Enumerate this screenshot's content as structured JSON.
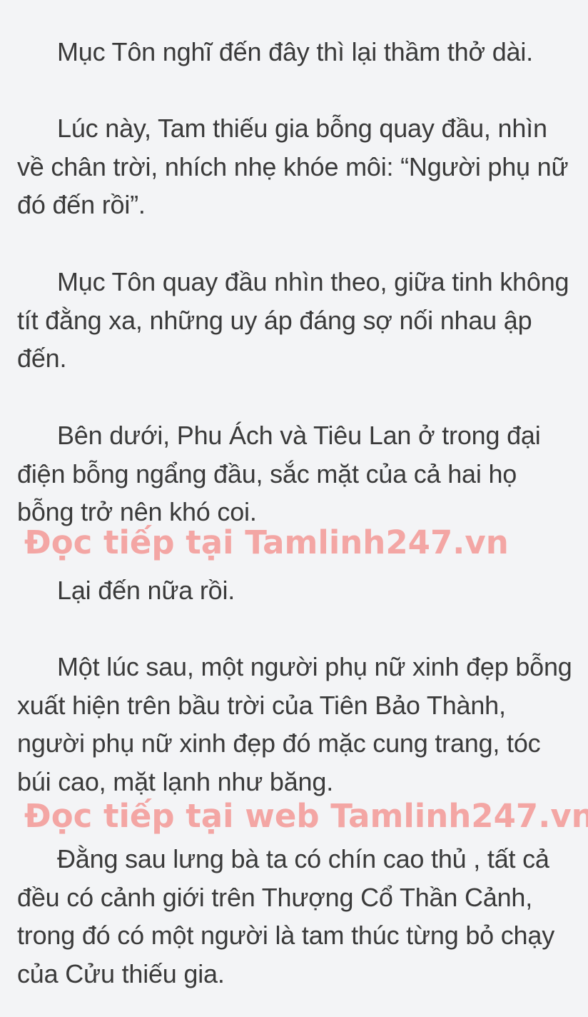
{
  "document": {
    "paragraphs": [
      "Mục Tôn nghĩ đến đây thì lại thầm thở dài.",
      "Lúc này, Tam thiếu gia bỗng quay đầu, nhìn về chân trời, nhích nhẹ khóe môi: “Người phụ nữ đó đến rồi”.",
      "Mục Tôn quay đầu nhìn theo, giữa tinh không tít đằng xa, những uy áp đáng sợ nối nhau ập đến.",
      "Bên dưới, Phu Ách và Tiêu Lan ở trong đại điện bỗng ngẩng đầu, sắc mặt của cả hai họ bỗng trở nên khó coi.",
      "Lại đến nữa rồi.",
      "Một lúc sau, một người phụ nữ xinh đẹp bỗng xuất hiện trên bầu trời của Tiên Bảo Thành, người phụ nữ xinh đẹp đó mặc cung trang, tóc búi cao, mặt lạnh như băng.",
      "Đằng sau lưng bà ta có chín cao thủ , tất cả đều có cảnh giới trên Thượng Cổ Thần Cảnh, trong đó có một người là tam thúc từng bỏ chạy của Cửu thiếu gia."
    ],
    "watermarks": [
      "Đọc tiếp tại Tamlinh247.vn",
      "Đọc tiếp tại web Tamlinh247.vn"
    ]
  },
  "colors": {
    "background": "#f3f4f6",
    "text": "#3a3a3a",
    "watermark": "#f3a6a4"
  }
}
